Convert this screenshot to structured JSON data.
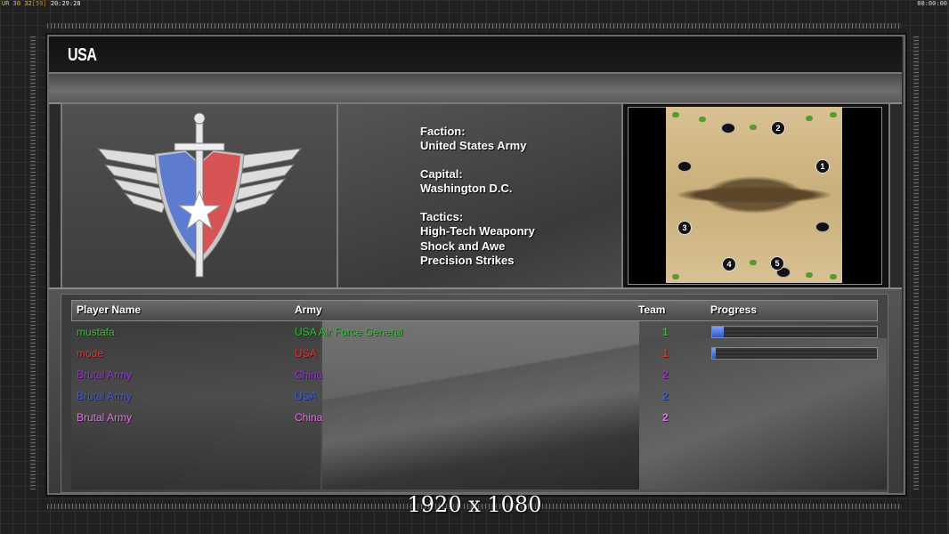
{
  "status_bar": {
    "left_a": "UR 30",
    "left_b": "32",
    "left_c": "[59]",
    "left_time": "20:29:28",
    "right_time": "00:00:00"
  },
  "faction_title": "USA",
  "info": {
    "faction_label": "Faction:",
    "faction_value": "United States Army",
    "capital_label": "Capital:",
    "capital_value": "Washington D.C.",
    "tactics_label": "Tactics:",
    "tactics": [
      "High-Tech Weaponry",
      "Shock and Awe",
      "Precision Strikes"
    ]
  },
  "map": {
    "start_positions": [
      "1",
      "2",
      "3",
      "4",
      "5"
    ]
  },
  "table": {
    "headers": {
      "player_name": "Player Name",
      "army": "Army",
      "team": "Team",
      "progress": "Progress"
    },
    "rows": [
      {
        "player": "mustafa",
        "army": "USA Air Force General",
        "team": "1",
        "color": "#2fbf2f",
        "team_color": "#2fbf2f",
        "progress": 0.07
      },
      {
        "player": "mode",
        "army": "USA",
        "team": "1",
        "color": "#e03030",
        "team_color": "#e03030",
        "progress": 0.02
      },
      {
        "player": "Brutal Army",
        "army": "China",
        "team": "2",
        "color": "#9a2ed8",
        "team_color": "#9a2ed8",
        "progress": null
      },
      {
        "player": "Brutal Army",
        "army": "USA",
        "team": "2",
        "color": "#3a5ae0",
        "team_color": "#3a5ae0",
        "progress": null
      },
      {
        "player": "Brutal Army",
        "army": "China",
        "team": "2",
        "color": "#e070e8",
        "team_color": "#e070e8",
        "progress": null
      }
    ]
  },
  "resolution_label": "1920 x 1080"
}
